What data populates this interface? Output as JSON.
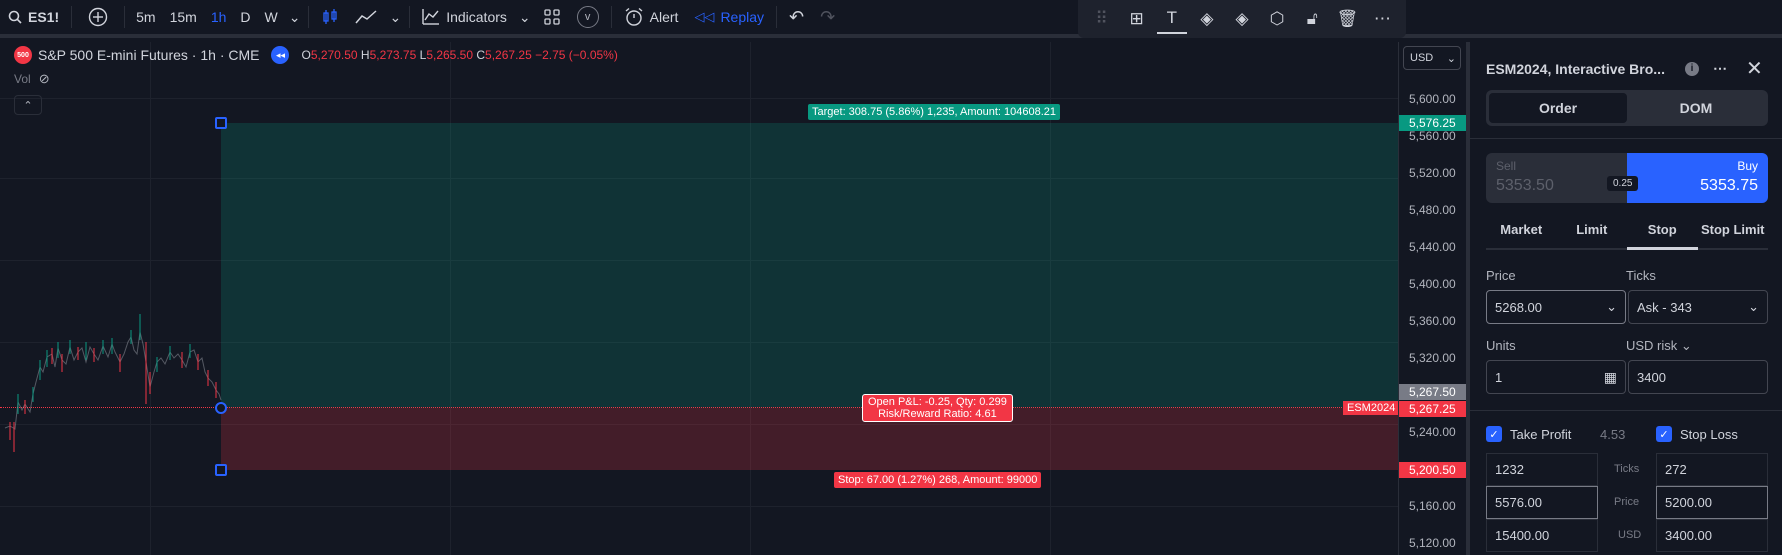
{
  "toolbar": {
    "symbol": "ES1!",
    "intervals": [
      "5m",
      "15m",
      "1h",
      "D",
      "W"
    ],
    "active_interval": "1h",
    "indicators_label": "Indicators",
    "v_badge": "v",
    "alert_label": "Alert",
    "replay_label": "Replay"
  },
  "legend": {
    "logo_text": "500",
    "title": "S&P 500 E-mini Futures · 1h · CME",
    "o_key": "O",
    "o_val": "5,270.50",
    "h_key": "H",
    "h_val": "5,273.75",
    "l_key": "L",
    "l_val": "5,265.50",
    "c_key": "C",
    "c_val": "5,267.25",
    "change": "−2.75 (−0.05%)",
    "vol_label": "Vol"
  },
  "position_tool": {
    "target_label": "Target: 308.75 (5.86%) 1,235, Amount: 104608.21",
    "stop_label": "Stop: 67.00 (1.27%) 268, Amount: 99000",
    "center_line1": "Open P&L: -0.25, Qty: 0.299",
    "center_line2": "Risk/Reward Ratio: 4.61",
    "symbol_tag": "ESM2024"
  },
  "price_axis": {
    "currency": "USD",
    "ticks": [
      "5,600.00",
      "5,560.00",
      "5,520.00",
      "5,480.00",
      "5,440.00",
      "5,400.00",
      "5,360.00",
      "5,320.00",
      "5,240.00",
      "5,160.00",
      "5,120.00"
    ],
    "target_tag": "5,576.25",
    "last_tag": "5,267.50",
    "entry_tag": "5,267.25",
    "stop_tag": "5,200.50"
  },
  "panel": {
    "title": "ESM2024, Interactive Bro...",
    "seg_order": "Order",
    "seg_dom": "DOM",
    "sell_label": "Sell",
    "sell_price": "5353.50",
    "buy_label": "Buy",
    "buy_price": "5353.75",
    "spread": "0.25",
    "order_types": [
      "Market",
      "Limit",
      "Stop",
      "Stop Limit"
    ],
    "active_type": "Stop",
    "price_label": "Price",
    "price_value": "5268.00",
    "ticks_label": "Ticks",
    "ticks_value": "Ask - 343",
    "units_label": "Units",
    "units_value": "1",
    "usd_risk_label": "USD risk",
    "usd_risk_value": "3400",
    "take_profit_label": "Take Profit",
    "ratio": "4.53",
    "stop_loss_label": "Stop Loss",
    "tp_ticks": "1232",
    "tp_price": "5576.00",
    "tp_usd": "15400.00",
    "sl_ticks": "272",
    "sl_price": "5200.00",
    "sl_usd": "3400.00",
    "row_ticks": "Ticks",
    "row_price": "Price",
    "row_usd": "USD"
  },
  "colors": {
    "accent": "#2962ff",
    "up": "#089981",
    "down": "#f23645",
    "background": "#131722"
  }
}
